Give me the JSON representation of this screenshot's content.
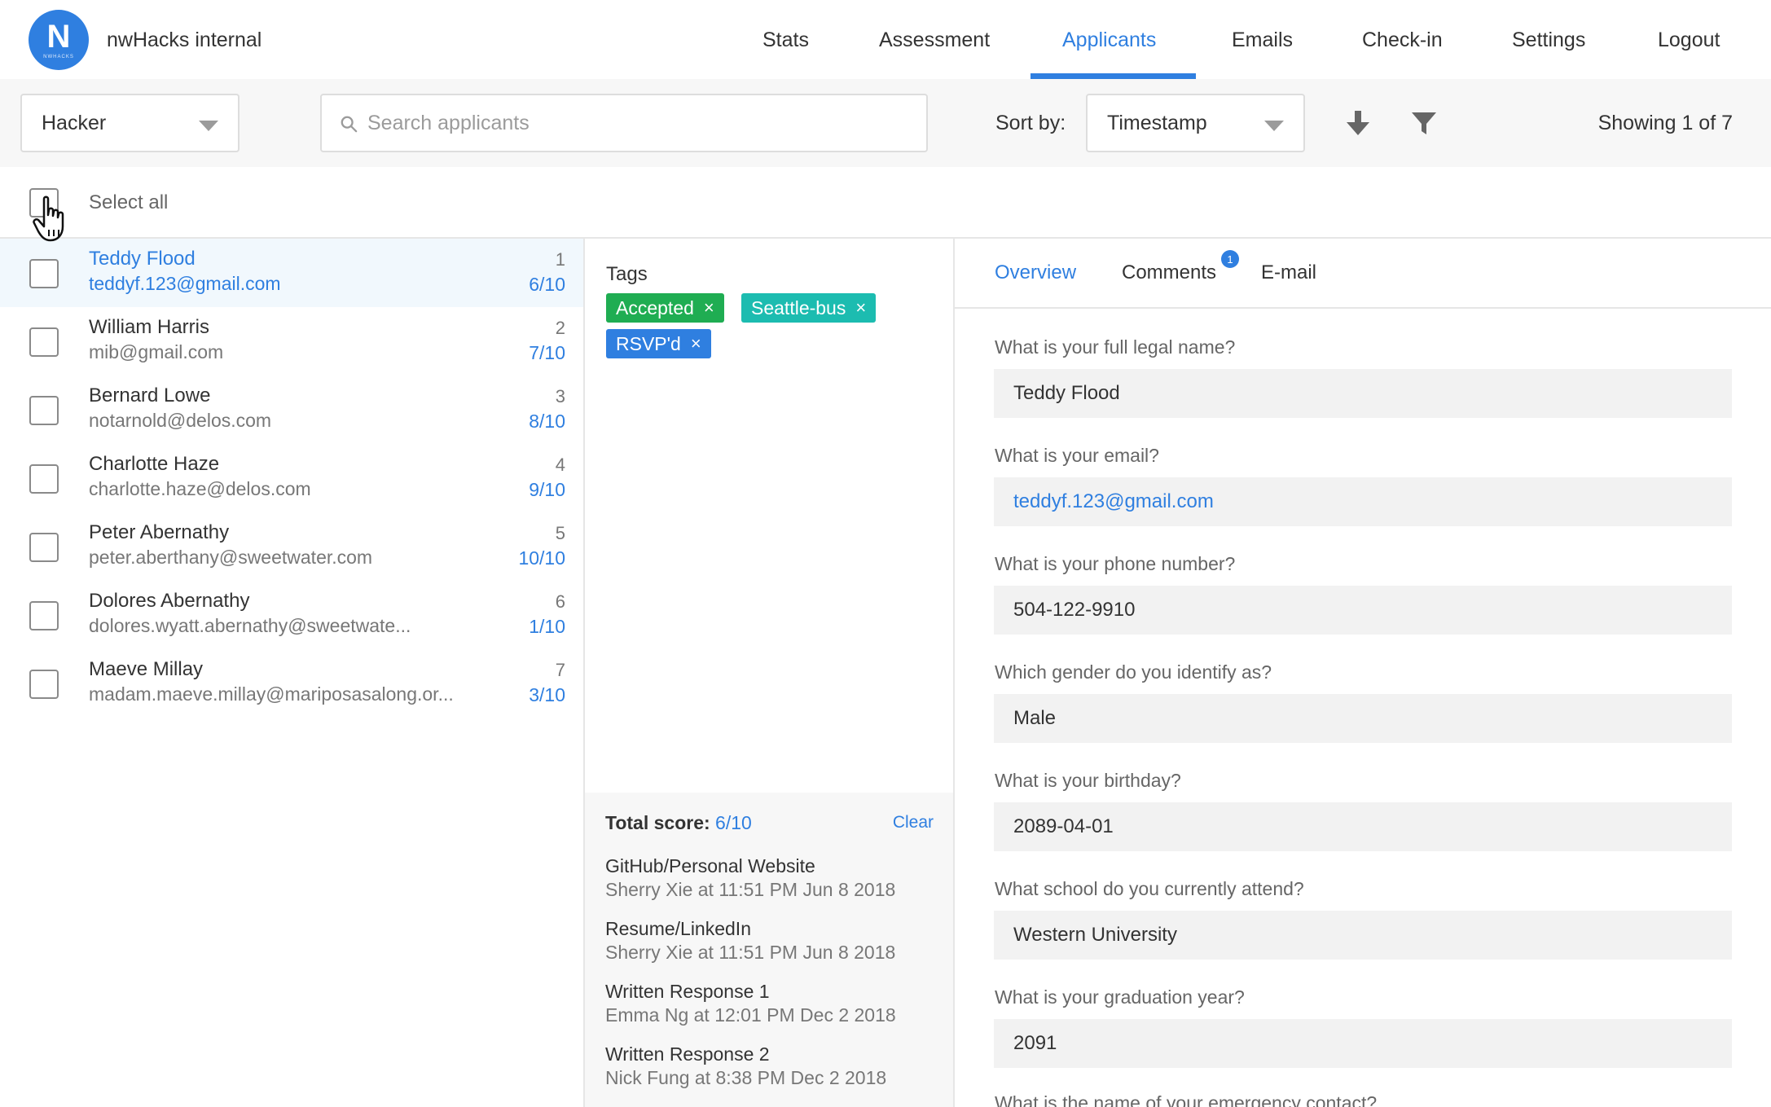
{
  "app": {
    "title": "nwHacks internal",
    "logo_letter": "N",
    "logo_small": "NWHACKS"
  },
  "nav": {
    "items": [
      {
        "label": "Stats"
      },
      {
        "label": "Assessment"
      },
      {
        "label": "Applicants",
        "active": true
      },
      {
        "label": "Emails"
      },
      {
        "label": "Check-in"
      },
      {
        "label": "Settings"
      },
      {
        "label": "Logout"
      }
    ]
  },
  "toolbar": {
    "type_filter": "Hacker",
    "search_placeholder": "Search applicants",
    "sort_label": "Sort by:",
    "sort_value": "Timestamp",
    "showing": "Showing 1 of 7"
  },
  "select_all_label": "Select all",
  "applicants": [
    {
      "name": "Teddy Flood",
      "email": "teddyf.123@gmail.com",
      "num": "1",
      "score": "6/10",
      "selected": true
    },
    {
      "name": "William Harris",
      "email": "mib@gmail.com",
      "num": "2",
      "score": "7/10"
    },
    {
      "name": "Bernard Lowe",
      "email": "notarnold@delos.com",
      "num": "3",
      "score": "8/10"
    },
    {
      "name": "Charlotte Haze",
      "email": "charlotte.haze@delos.com",
      "num": "4",
      "score": "9/10"
    },
    {
      "name": "Peter Abernathy",
      "email": "peter.aberthany@sweetwater.com",
      "num": "5",
      "score": "10/10"
    },
    {
      "name": "Dolores Abernathy",
      "email": "dolores.wyatt.abernathy@sweetwate...",
      "num": "6",
      "score": "1/10"
    },
    {
      "name": "Maeve Millay",
      "email": "madam.maeve.millay@mariposasalong.or...",
      "num": "7",
      "score": "3/10"
    }
  ],
  "tags": {
    "title": "Tags",
    "items": [
      {
        "label": "Accepted",
        "remove": "×",
        "color": "#1fad52"
      },
      {
        "label": "Seattle-bus",
        "remove": "×",
        "color": "#1cbcb0"
      },
      {
        "label": "RSVP'd",
        "remove": "×",
        "color": "#2f7fe0"
      }
    ]
  },
  "scores": {
    "total_label": "Total score:",
    "total_value": "6/10",
    "clear_label": "Clear",
    "items": [
      {
        "criterion": "GitHub/Personal Website",
        "by": "Sherry Xie at 11:51 PM Jun 8 2018"
      },
      {
        "criterion": "Resume/LinkedIn",
        "by": "Sherry Xie at 11:51 PM Jun 8 2018"
      },
      {
        "criterion": "Written Response 1",
        "by": "Emma Ng at 12:01 PM Dec 2 2018"
      },
      {
        "criterion": "Written Response 2",
        "by": "Nick Fung at 8:38 PM Dec 2 2018"
      }
    ]
  },
  "detail_tabs": [
    {
      "label": "Overview",
      "active": true
    },
    {
      "label": "Comments",
      "badge": "1"
    },
    {
      "label": "E-mail"
    }
  ],
  "questions": [
    {
      "q": "What is your full legal name?",
      "a": "Teddy Flood"
    },
    {
      "q": "What is your email?",
      "a": "teddyf.123@gmail.com",
      "link": true
    },
    {
      "q": "What is your phone number?",
      "a": "504-122-9910"
    },
    {
      "q": "Which gender do you identify as?",
      "a": "Male"
    },
    {
      "q": "What is your birthday?",
      "a": "2089-04-01"
    },
    {
      "q": "What school do you currently attend?",
      "a": "Western University"
    },
    {
      "q": "What is your graduation year?",
      "a": "2091"
    },
    {
      "q": "What is the name of your emergency contact?",
      "a": ""
    }
  ],
  "colors": {
    "accent": "#2f7fe0",
    "accepted": "#1fad52",
    "seattle": "#1cbcb0",
    "rsvp": "#2f7fe0"
  },
  "icons": [
    "search-icon",
    "sort-descending-icon",
    "filter-icon",
    "dropdown-caret-icon",
    "remove-tag-icon",
    "pointer-cursor-icon"
  ]
}
